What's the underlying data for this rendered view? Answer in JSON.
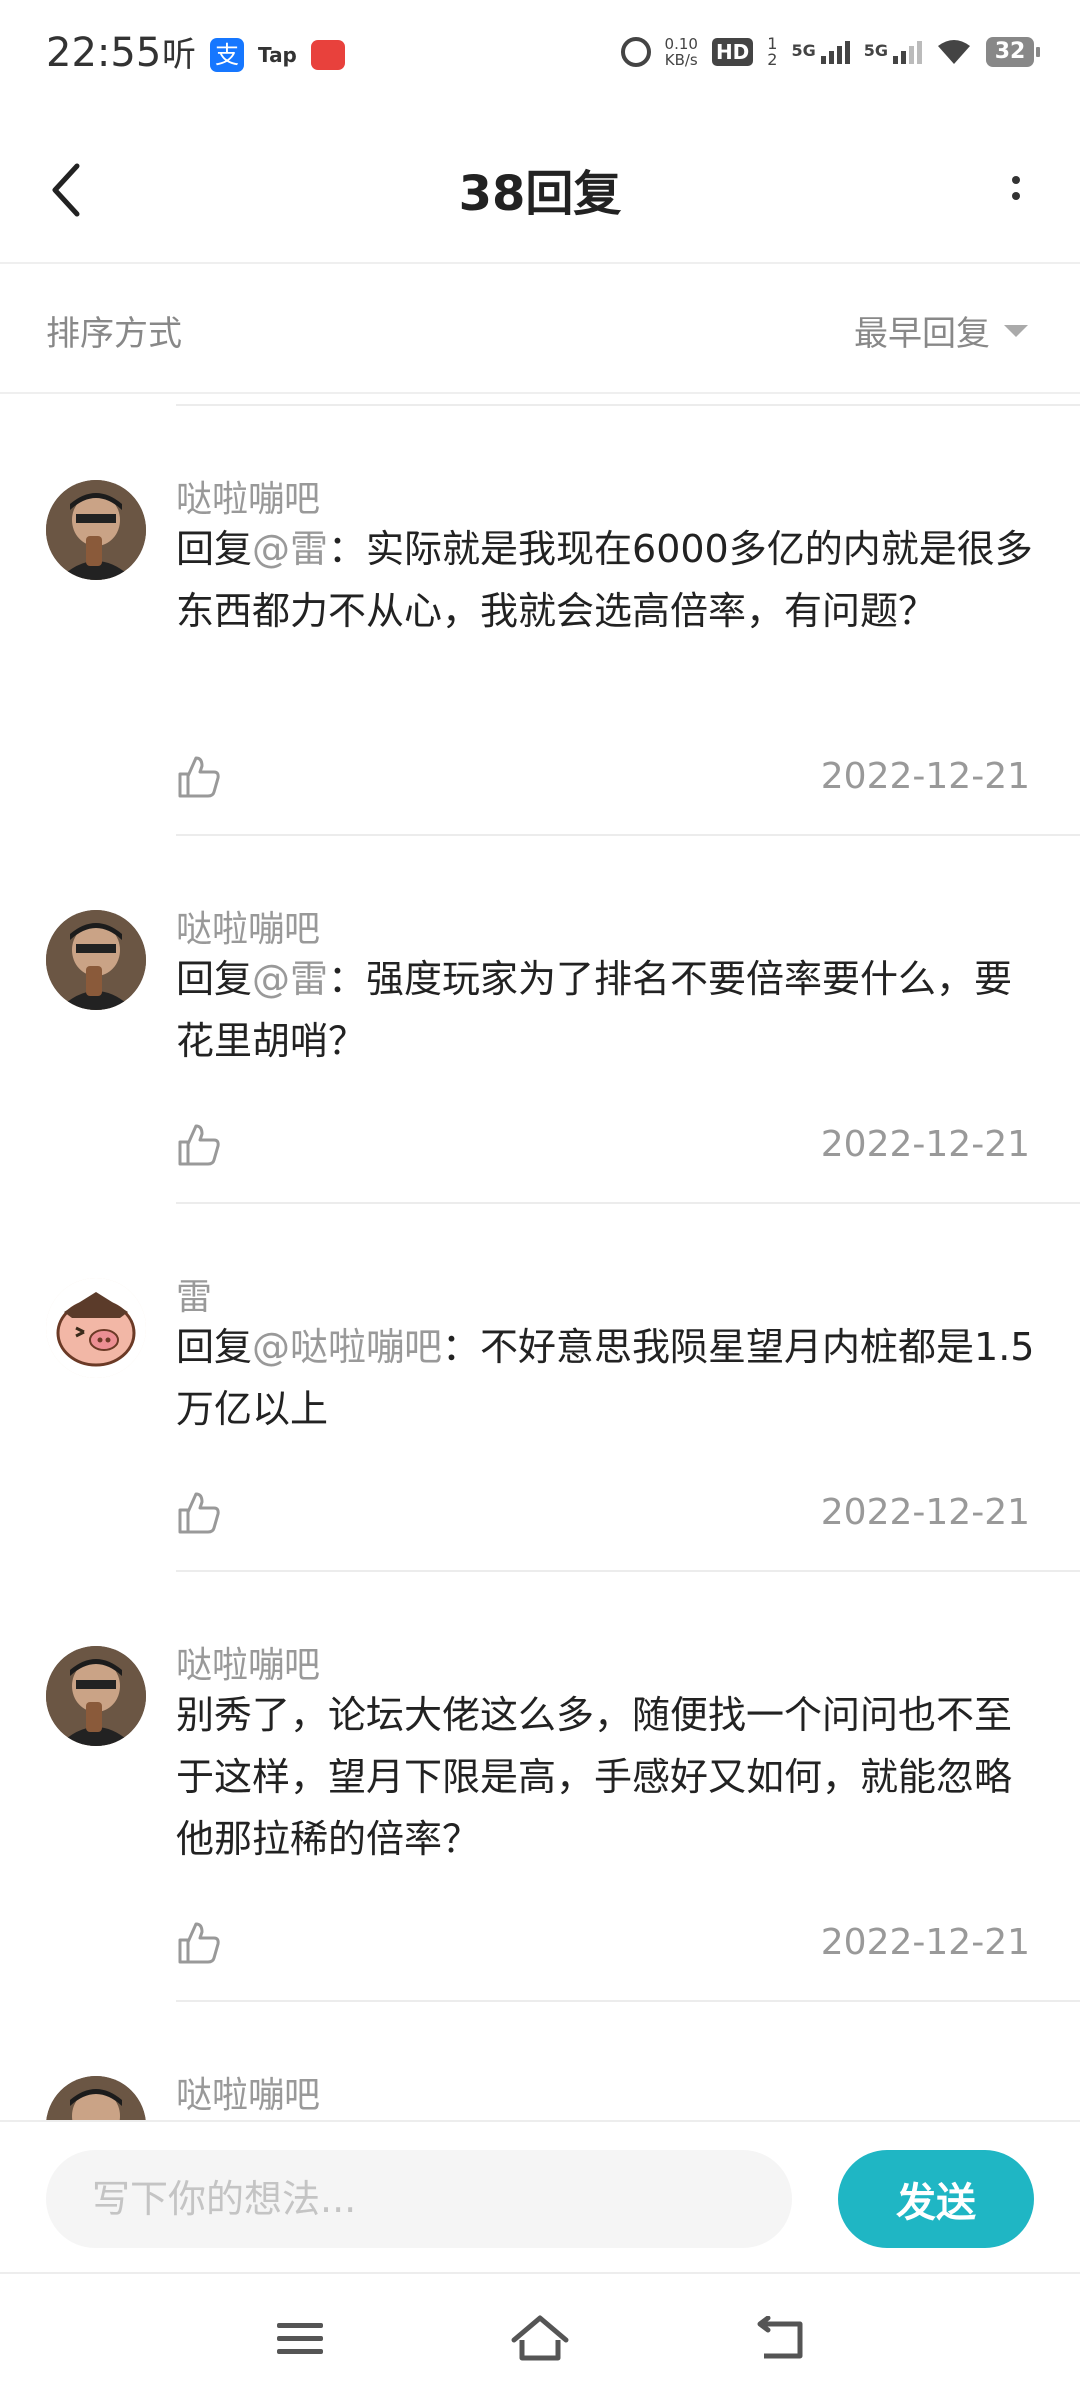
{
  "status_bar": {
    "time": "22:55",
    "ting": "听",
    "tap_label": "Tap",
    "net_speed_value": "0.10",
    "net_speed_unit": "KB/s",
    "hd_label": "HD",
    "hd_sub": "1",
    "hd_sub2": "2",
    "sim1": "5G",
    "sim2": "5G",
    "battery": "32"
  },
  "header": {
    "title": "38回复"
  },
  "sort": {
    "label": "排序方式",
    "value": "最早回复"
  },
  "replies": [
    {
      "name": "哒啦嘣吧",
      "prefix": "回复",
      "mention": "@雷",
      "text": "：实际就是我现在6000多亿的内就是很多东西都力不从心，我就会选高倍率，有问题？",
      "date": "2022-12-21"
    },
    {
      "name": "哒啦嘣吧",
      "prefix": "回复",
      "mention": "@雷",
      "text": "：强度玩家为了排名不要倍率要什么，要花里胡哨？",
      "date": "2022-12-21"
    },
    {
      "name": "雷",
      "prefix": "回复",
      "mention": "@哒啦嘣吧",
      "text": "：不好意思我陨星望月内桩都是1.5万亿以上",
      "date": "2022-12-21"
    },
    {
      "name": "哒啦嘣吧",
      "prefix": "",
      "mention": "",
      "text": "别秀了，论坛大佬这么多，随便找一个问问也不至于这样，望月下限是高，手感好又如何，就能忽略他那拉稀的倍率？",
      "date": "2022-12-21"
    },
    {
      "name": "哒啦嘣吧"
    }
  ],
  "composer": {
    "placeholder": "写下你的想法...",
    "send_label": "发送"
  },
  "colors": {
    "accent": "#1fb6c4",
    "muted_text": "#999999",
    "body_text": "#222222"
  }
}
